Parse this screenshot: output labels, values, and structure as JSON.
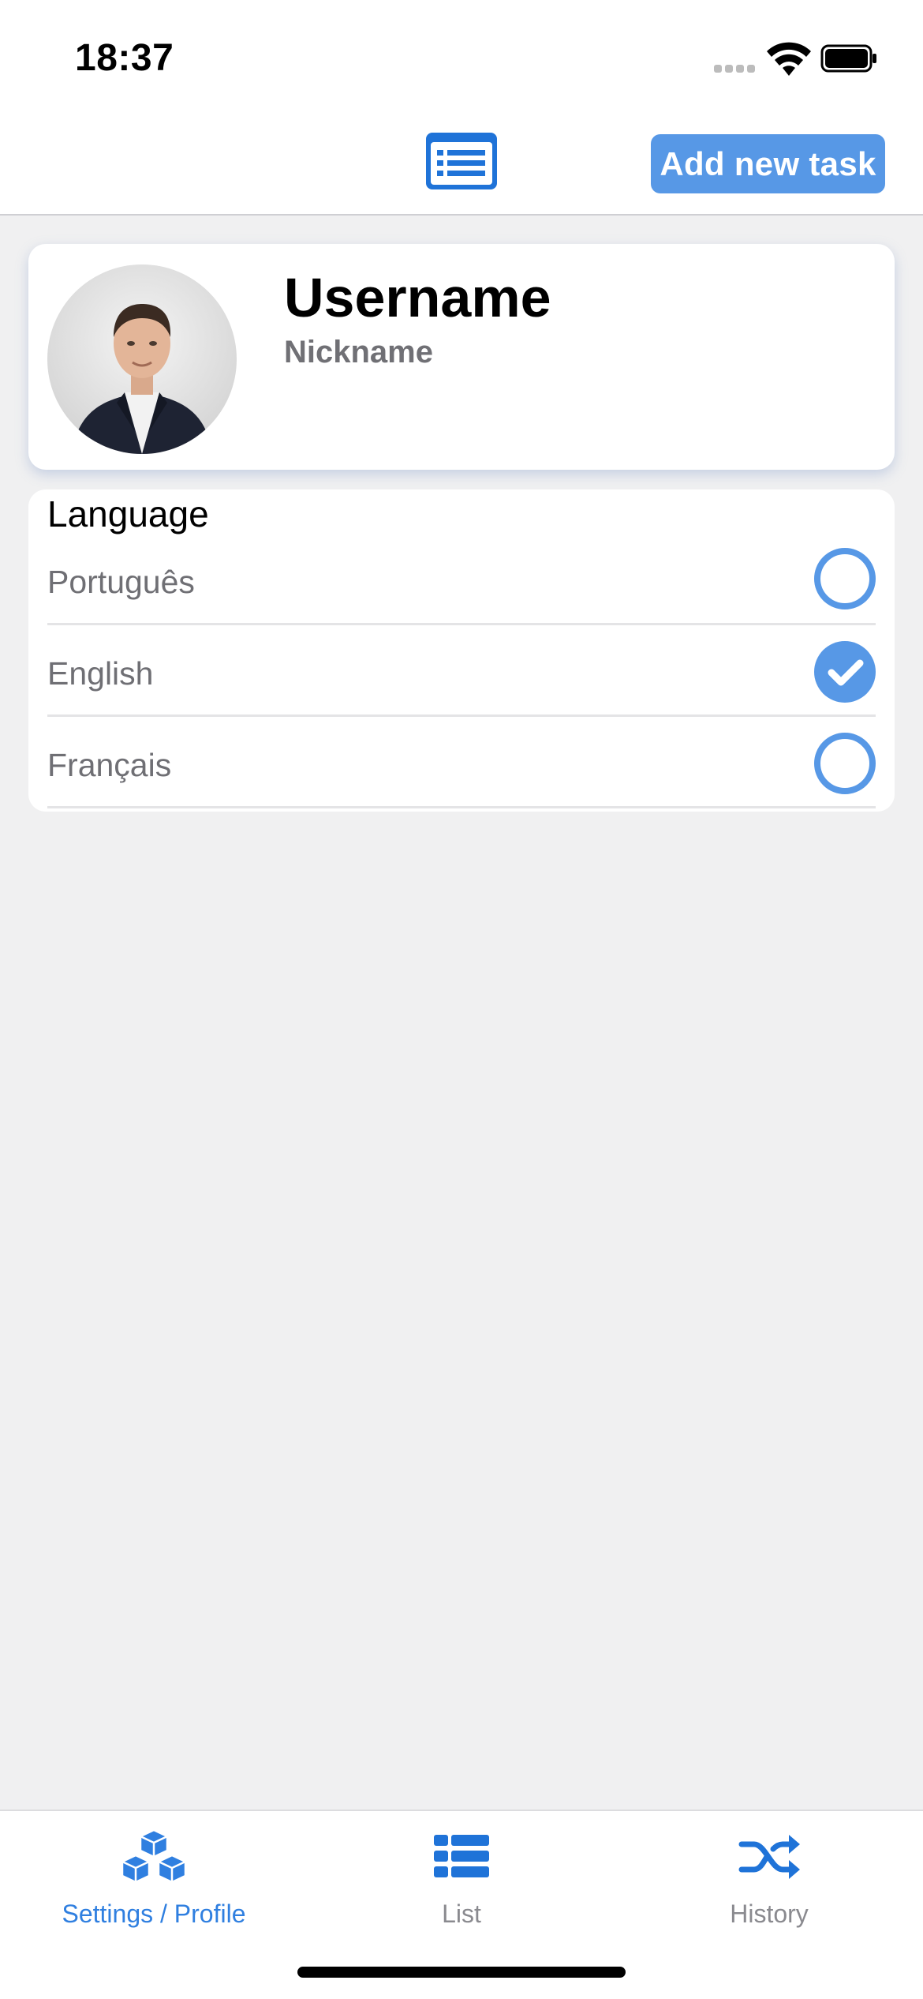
{
  "status_bar": {
    "time": "18:37",
    "signal_icon": "cellular-signal-icon",
    "wifi_icon": "wifi-icon",
    "battery_icon": "battery-full-icon"
  },
  "header": {
    "center_icon": "list-card-icon",
    "add_button_label": "Add new task"
  },
  "profile": {
    "avatar": "profile-photo",
    "username": "Username",
    "nickname": "Nickname"
  },
  "language": {
    "title": "Language",
    "options": [
      {
        "label": "Português",
        "selected": false
      },
      {
        "label": "English",
        "selected": true
      },
      {
        "label": "Français",
        "selected": false
      }
    ]
  },
  "tabbar": {
    "tabs": [
      {
        "label": "Settings / Profile",
        "icon": "cubes-icon",
        "active": true
      },
      {
        "label": "List",
        "icon": "list-icon",
        "active": false
      },
      {
        "label": "History",
        "icon": "shuffle-icon",
        "active": false
      }
    ]
  },
  "colors": {
    "accent": "#5798e6",
    "active_tab": "#2f7fe0",
    "background": "#f0f0f1",
    "muted_text": "#6f6f74"
  }
}
